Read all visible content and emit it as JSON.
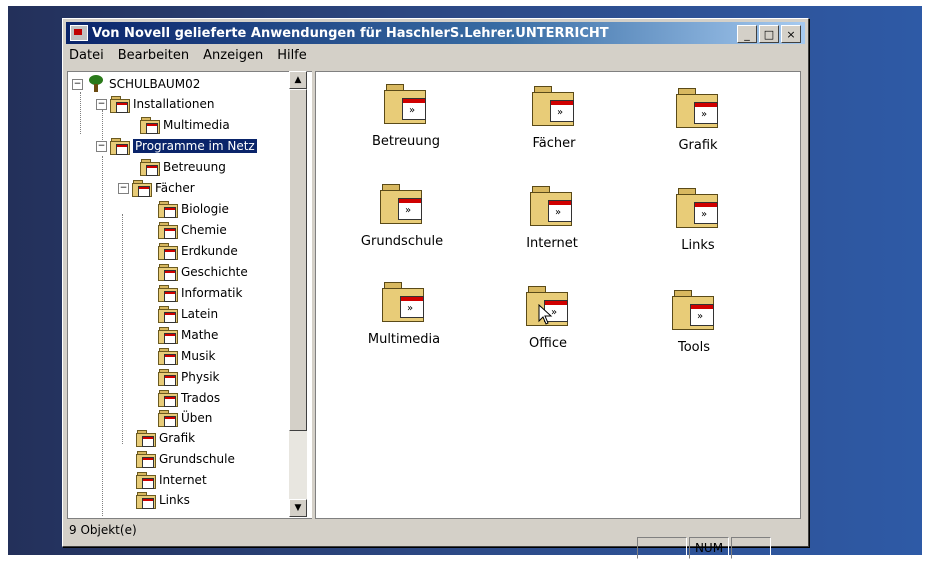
{
  "window": {
    "title": "Von Novell gelieferte Anwendungen für HaschlerS.Lehrer.UNTERRICHT",
    "buttons": [
      "minimize",
      "maximize",
      "close"
    ]
  },
  "menu": [
    "Datei",
    "Bearbeiten",
    "Anzeigen",
    "Hilfe"
  ],
  "tree": {
    "root": "SCHULBAUM02",
    "nodes": {
      "installationen": "Installationen",
      "multimedia_inst": "Multimedia",
      "programme": "Programme im Netz",
      "betreuung": "Betreuung",
      "faecher": "Fächer",
      "biologie": "Biologie",
      "chemie": "Chemie",
      "erdkunde": "Erdkunde",
      "geschichte": "Geschichte",
      "informatik": "Informatik",
      "latein": "Latein",
      "mathe": "Mathe",
      "musik": "Musik",
      "physik": "Physik",
      "trados": "Trados",
      "ueben": "Üben",
      "grafik": "Grafik",
      "grundschule": "Grundschule",
      "internet": "Internet",
      "links": "Links"
    }
  },
  "content": {
    "folders": [
      "Betreuung",
      "Fächer",
      "Grafik",
      "Grundschule",
      "Internet",
      "Links",
      "Multimedia",
      "Office",
      "Tools"
    ]
  },
  "status": {
    "objects": "9 Objekt(e)",
    "num": "NUM"
  },
  "icons": [
    "tree-icon",
    "folder-icon",
    "minimize-icon",
    "maximize-icon",
    "close-icon",
    "scroll-up-icon",
    "scroll-down-icon",
    "mouse-cursor-icon"
  ]
}
